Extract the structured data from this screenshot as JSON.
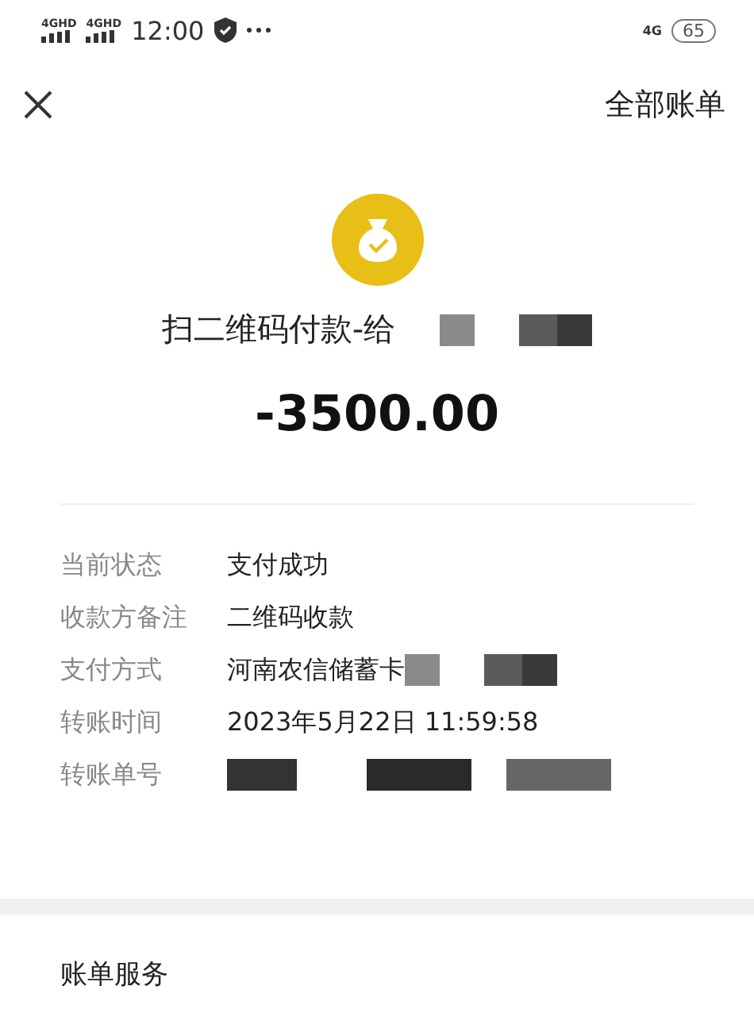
{
  "status_bar": {
    "signals": [
      "4GHD",
      "4GHD"
    ],
    "time": "12:00",
    "network": "4G",
    "battery": "65"
  },
  "header": {
    "link": "全部账单"
  },
  "summary": {
    "title": "扫二维码付款-给",
    "amount": "-3500.00"
  },
  "details": [
    {
      "label": "当前状态",
      "value": "支付成功",
      "redacted": false
    },
    {
      "label": "收款方备注",
      "value": "二维码收款",
      "redacted": false
    },
    {
      "label": "支付方式",
      "value": "河南农信储蓄卡",
      "redacted": true
    },
    {
      "label": "转账时间",
      "value": "2023年5月22日 11:59:58",
      "redacted": false
    },
    {
      "label": "转账单号",
      "redacted": true
    }
  ],
  "section": {
    "title": "账单服务"
  }
}
